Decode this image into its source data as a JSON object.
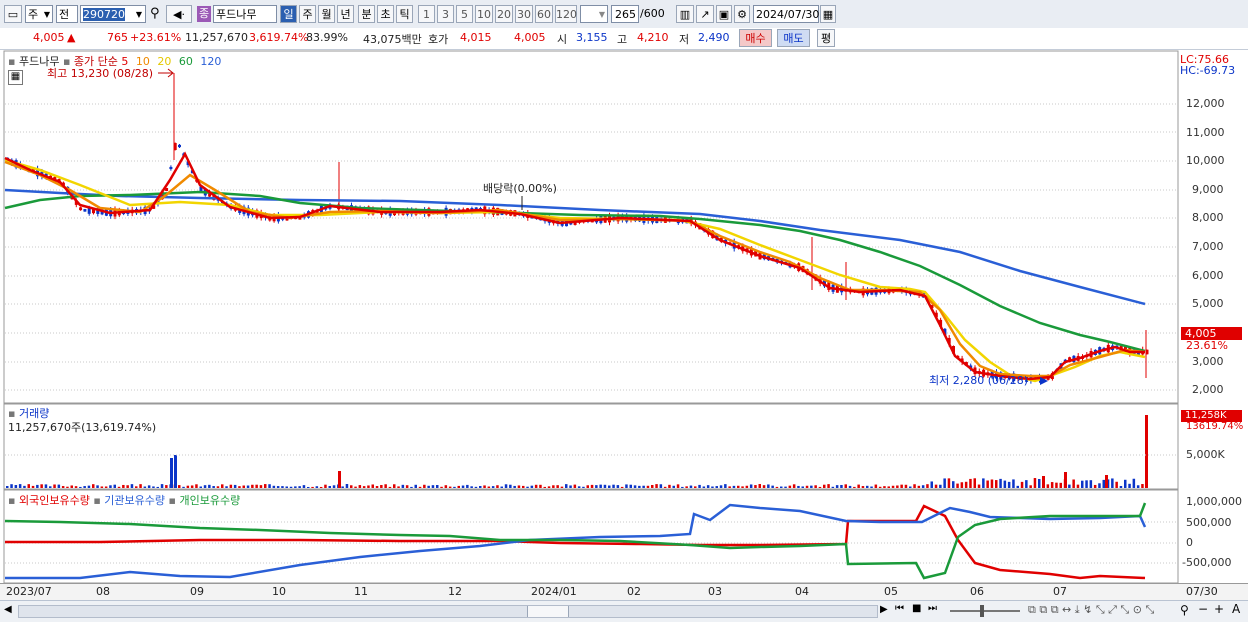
{
  "toolbar": {
    "period_select": "주",
    "market_select": "전",
    "stock_code": "290720",
    "stock_badge": "종",
    "stock_name": "푸드나무",
    "intervals": [
      "일",
      "주",
      "월",
      "년",
      "분",
      "초",
      "틱"
    ],
    "interval_nums": [
      "1",
      "3",
      "5",
      "10",
      "20",
      "30",
      "60",
      "120"
    ],
    "count": "265",
    "count_total": "/600",
    "date": "2024/07/30"
  },
  "info": {
    "price": "4,005",
    "change_arrow": "▲",
    "change": "765",
    "change_rate": "+23.61%",
    "volume": "11,257,670",
    "volume_rate": "3,619.74%",
    "turnover": "83.99%",
    "amount": "43,075백만",
    "bid_label": "호가",
    "ask_price": "4,015",
    "bid_price": "4,005",
    "open_label": "시",
    "open_price": "3,155",
    "high_label": "고",
    "high_price": "4,210",
    "low_label": "저",
    "low_price": "2,490",
    "buy_btn": "매수",
    "sell_btn": "매도",
    "eval_btn": "평"
  },
  "price_panel": {
    "title": "푸드나무",
    "ma_title": "종가 단순",
    "ma_periods": [
      "5",
      "10",
      "20",
      "60",
      "120"
    ],
    "ma_colors": [
      "#e00000",
      "#f08a00",
      "#f2d500",
      "#1a9a3a",
      "#2a5fd6"
    ],
    "high_marker": "최고 13,230 (08/28)",
    "low_marker": "최저 2,280 (06/28)",
    "dividend_marker": "배당락(0.00%)",
    "lc": "LC:75.66",
    "hc": "HC:-69.73",
    "current_price": "4,005",
    "current_rate": "23.61%",
    "y_ticks": [
      "12,000",
      "11,000",
      "10,000",
      "9,000",
      "8,000",
      "7,000",
      "6,000",
      "5,000",
      "4,000",
      "3,000",
      "2,000"
    ]
  },
  "volume_panel": {
    "title": "거래량",
    "value_text": "11,257,670주(13,619.74%)",
    "current_value": "11,258K",
    "current_rate": "13619.74%",
    "y_ticks": [
      "5,000K"
    ]
  },
  "holding_panel": {
    "series": [
      "외국인보유수량",
      "기관보유수량",
      "개인보유수량"
    ],
    "colors": [
      "#e00000",
      "#2a5fd6",
      "#1a9a3a"
    ],
    "y_ticks": [
      "1,000,000",
      "500,000",
      "0",
      "-500,000"
    ]
  },
  "date_axis": {
    "labels": [
      "2023/07",
      "08",
      "09",
      "10",
      "11",
      "12",
      "2024/01",
      "02",
      "03",
      "04",
      "05",
      "06",
      "07"
    ],
    "right_label": "07/30"
  }
}
